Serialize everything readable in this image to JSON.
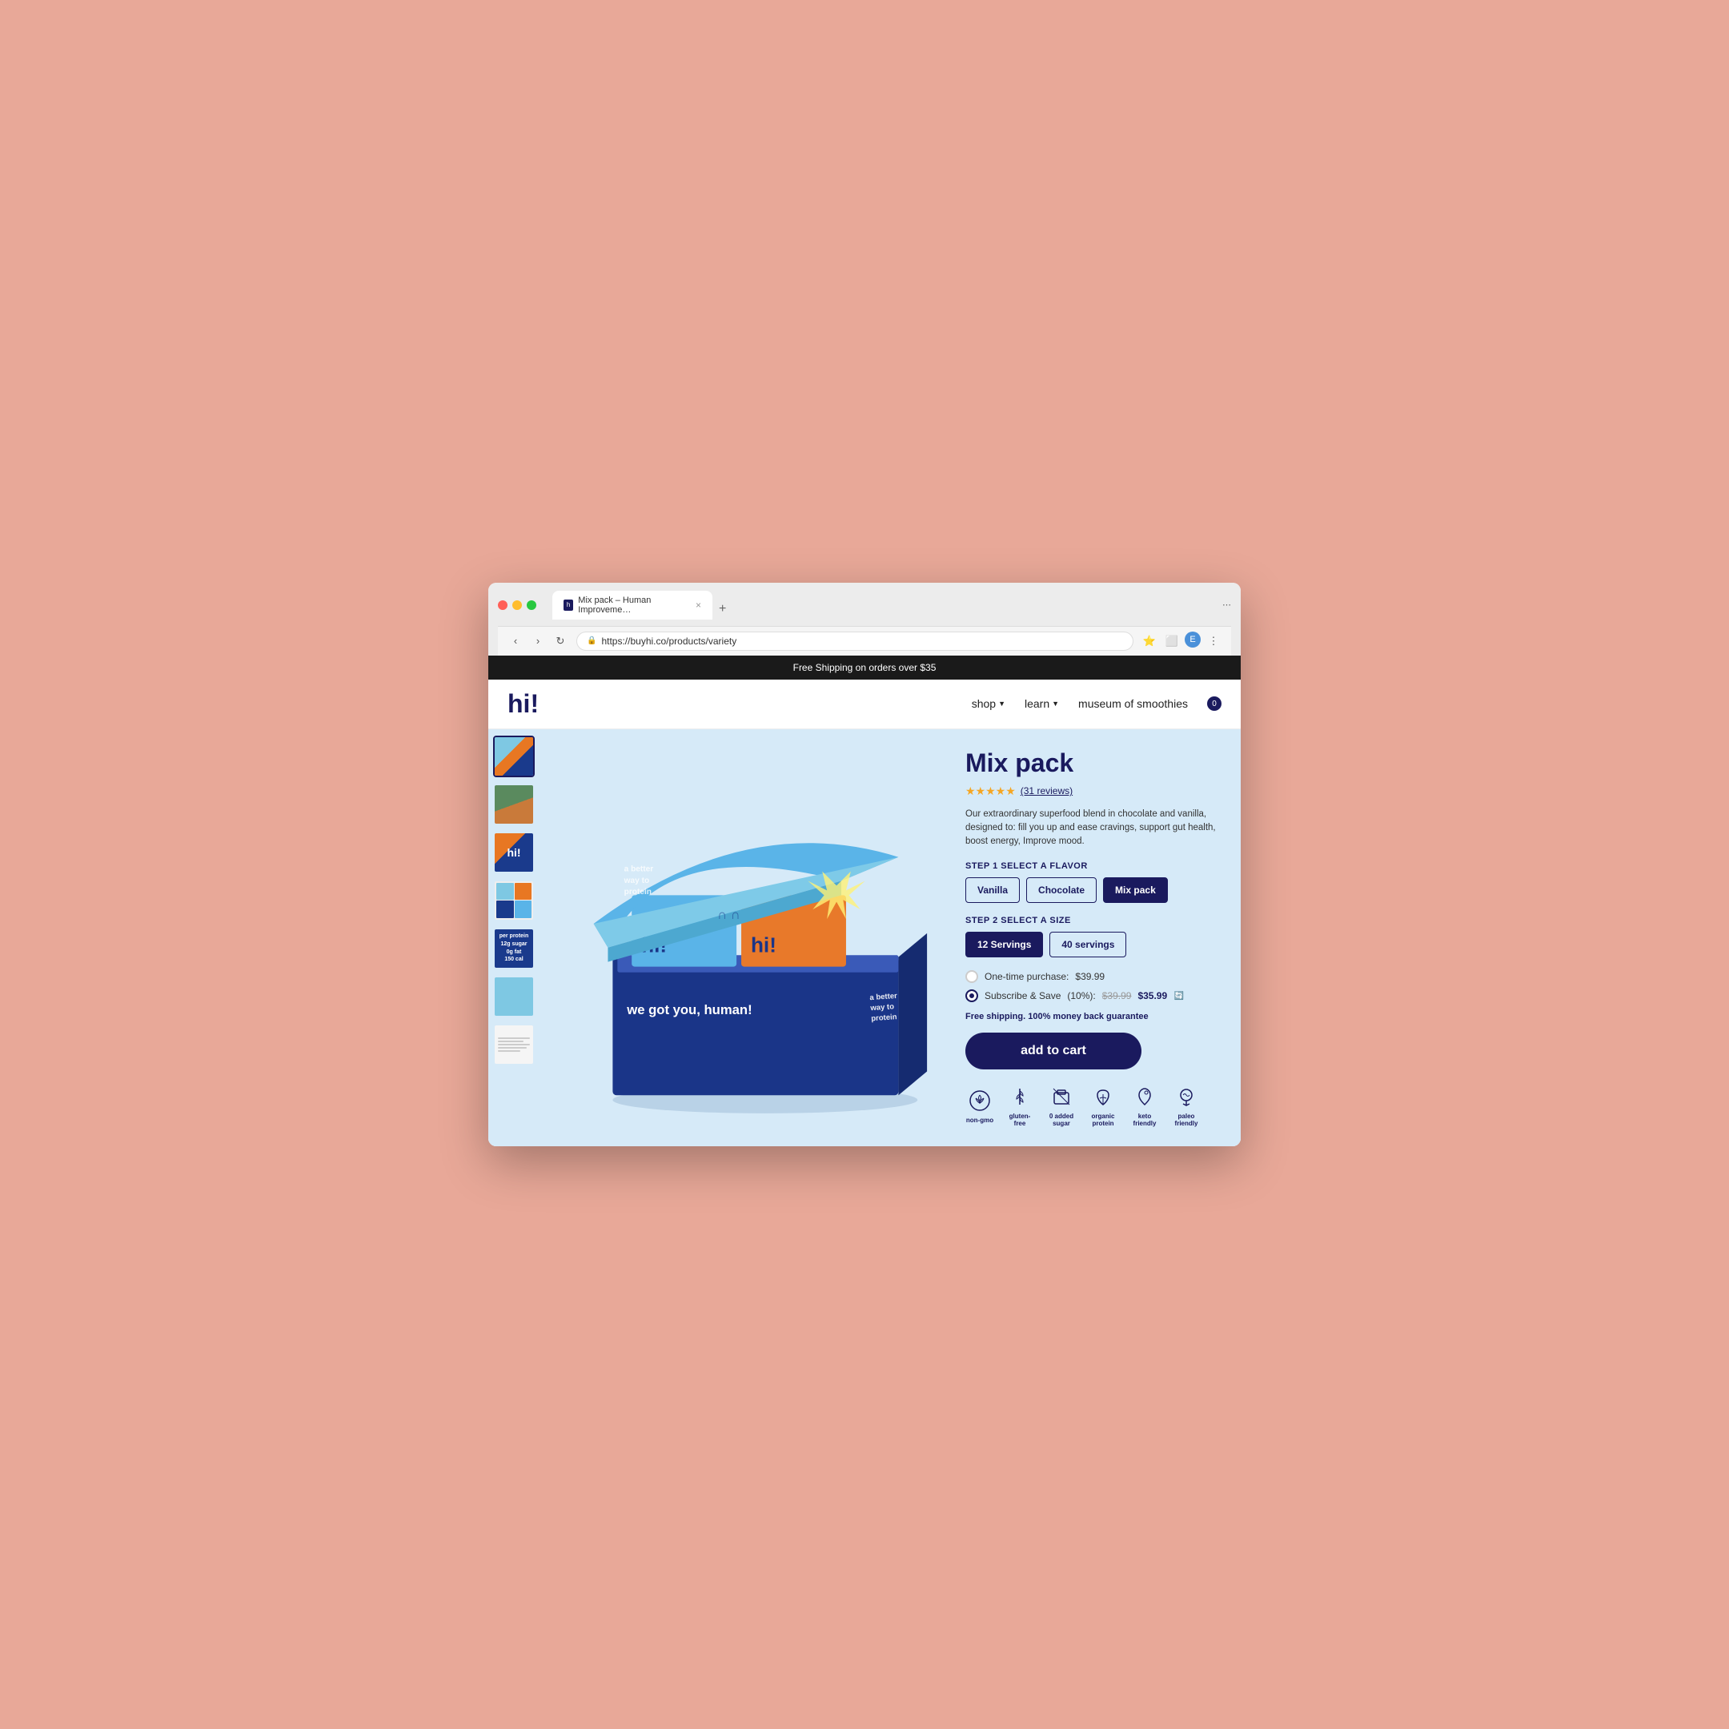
{
  "browser": {
    "tab_title": "Mix pack – Human Improveme…",
    "tab_close": "×",
    "new_tab": "+",
    "url": "https://buyhi.co/products/variety",
    "back_btn": "‹",
    "forward_btn": "›",
    "reload_btn": "↻"
  },
  "announcement": {
    "text": "Free Shipping on orders over $35"
  },
  "header": {
    "logo": "hi!",
    "nav": {
      "shop": "shop",
      "learn": "learn",
      "museum": "museum of smoothies",
      "cart_count": "0"
    }
  },
  "product": {
    "title": "Mix pack",
    "stars": "★★★★★",
    "review_count": "(31 reviews)",
    "description": "Our extraordinary superfood blend in chocolate and vanilla, designed to: fill you up and ease cravings, support gut health, boost energy, Improve mood.",
    "step1_label": "STEP 1 Select a Flavor",
    "flavors": [
      {
        "label": "Vanilla",
        "active": false
      },
      {
        "label": "Chocolate",
        "active": false
      },
      {
        "label": "Mix pack",
        "active": true
      }
    ],
    "step2_label": "STEP 2 Select a Size",
    "sizes": [
      {
        "label": "12 Servings",
        "active": true
      },
      {
        "label": "40 servings",
        "active": false
      }
    ],
    "one_time_label": "One-time purchase:",
    "one_time_price": "$39.99",
    "subscribe_label": "Subscribe & Save",
    "subscribe_discount": "(10%):",
    "subscribe_price_original": "$39.99",
    "subscribe_price_discounted": "$35.99",
    "free_shipping": "Free shipping. 100% money back guarantee",
    "add_to_cart": "add to cart",
    "badges": [
      {
        "icon": "🧬",
        "label": "non-gmo"
      },
      {
        "icon": "🌾",
        "label": "gluten-free"
      },
      {
        "icon": "📦",
        "label": "0 added sugar"
      },
      {
        "icon": "🌿",
        "label": "organic protein"
      },
      {
        "icon": "🥑",
        "label": "keto friendly"
      },
      {
        "icon": "🌱",
        "label": "paleo friendly"
      }
    ]
  },
  "thumbnails": [
    {
      "id": 1,
      "active": true
    },
    {
      "id": 2,
      "active": false
    },
    {
      "id": 3,
      "active": false
    },
    {
      "id": 4,
      "active": false
    },
    {
      "id": 5,
      "active": false
    },
    {
      "id": 6,
      "active": false
    },
    {
      "id": 7,
      "active": false
    }
  ]
}
